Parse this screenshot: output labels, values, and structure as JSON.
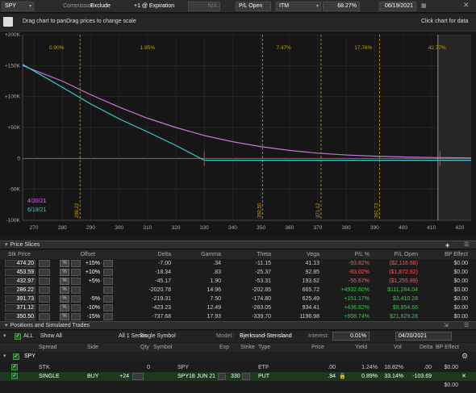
{
  "toolbar": {
    "symbol": "SPY",
    "commission_label": "Commission:",
    "commission_value": "Exclude",
    "expiration_mode": "+1 @ Expiration",
    "na_field": "N/A",
    "pl_mode": "P/L Open",
    "itm": "ITM",
    "probability": "68.27%",
    "date": "06/19/2021"
  },
  "chart_header": {
    "hint": "Drag chart to panDrag prices to change scale",
    "click_hint": "Click chart for data"
  },
  "chart_data": {
    "type": "line",
    "x_ticks": [
      270,
      280,
      290,
      300,
      310,
      320,
      330,
      340,
      350,
      360,
      370,
      380,
      390,
      400,
      410,
      420
    ],
    "y_ticks": [
      "+200K",
      "+150K",
      "+100K",
      "+50K",
      "0",
      "-50K",
      "-100K"
    ],
    "ylim": [
      -100000,
      200000
    ],
    "xlim": [
      266,
      424
    ],
    "prob_labels": [
      {
        "text": "0.90%",
        "x": 278
      },
      {
        "text": "1.95%",
        "x": 310
      },
      {
        "text": "7.47%",
        "x": 358
      },
      {
        "text": "17.76%",
        "x": 386
      },
      {
        "text": "42.77%",
        "x": 412
      }
    ],
    "vlines": [
      {
        "label": "286.22",
        "x": 286.22
      },
      {
        "label": "350.50",
        "x": 350.5
      },
      {
        "label": "371.12",
        "x": 371.12
      },
      {
        "label": "391.73",
        "x": 391.73
      }
    ],
    "solid_vline": 412.3,
    "markers": [
      330,
      413
    ],
    "series": [
      {
        "name": "4/20/21",
        "color": "#d070e0",
        "x": [
          266,
          280,
          290,
          300,
          310,
          320,
          330,
          340,
          350,
          360,
          370,
          380,
          390,
          400,
          410,
          424
        ],
        "y": [
          150000,
          125000,
          103000,
          83000,
          65000,
          50000,
          37000,
          27000,
          19000,
          13000,
          8500,
          5600,
          3700,
          2400,
          1500,
          800
        ]
      },
      {
        "name": "6/19/21",
        "color": "#30d0c8",
        "x": [
          266,
          280,
          290,
          300,
          310,
          320,
          330,
          340,
          380,
          424
        ],
        "y": [
          152000,
          115000,
          88000,
          64000,
          43000,
          21000,
          -3000,
          -3000,
          -3000,
          -3000
        ]
      }
    ]
  },
  "price_slices": {
    "title": "Price Slices",
    "headers": [
      "Stk Price",
      "Offset",
      "Delta",
      "Gamma",
      "Theta",
      "Vega",
      "P/L %",
      "P/L Open",
      "BP Effect"
    ],
    "rows": [
      {
        "price": "474.20",
        "offset": "+15%",
        "delta": "-7.00",
        "gamma": ".34",
        "theta": "-11.15",
        "vega": "41.13",
        "plpct": "-93.82%",
        "plopen": "($2,116.68)",
        "bp": "$0.00",
        "neg": true
      },
      {
        "price": "453.59",
        "offset": "+10%",
        "delta": "-18.34",
        "gamma": ".83",
        "theta": "-25.37",
        "vega": "92.85",
        "plpct": "-83.02%",
        "plopen": "($1,872.92)",
        "bp": "$0.00",
        "neg": true
      },
      {
        "price": "432.97",
        "offset": "+5%",
        "delta": "-45.17",
        "gamma": "1.90",
        "theta": "-53.31",
        "vega": "193.62",
        "plpct": "-55.67%",
        "plopen": "($1,255.89)",
        "bp": "$0.00",
        "neg": true
      },
      {
        "price": "286.22",
        "offset": "",
        "delta": "-2020.78",
        "gamma": "14.96",
        "theta": "-202.85",
        "vega": "665.72",
        "plpct": "+4932.80%",
        "plopen": "$111,284.04",
        "bp": "$0.00",
        "neg": false
      },
      {
        "price": "391.73",
        "offset": "-5%",
        "delta": "-219.31",
        "gamma": "7.50",
        "theta": "-174.80",
        "vega": "625.49",
        "plpct": "+151.17%",
        "plopen": "$3,410.28",
        "bp": "$0.00",
        "neg": false
      },
      {
        "price": "371.12",
        "offset": "-10%",
        "delta": "-423.23",
        "gamma": "12.49",
        "theta": "-263.05",
        "vega": "934.41",
        "plpct": "+436.82%",
        "plopen": "$9,854.66",
        "bp": "$0.00",
        "neg": false
      },
      {
        "price": "350.50",
        "offset": "-15%",
        "delta": "-737.68",
        "gamma": "17.93",
        "theta": "-339.70",
        "vega": "1196.98",
        "plpct": "+958.74%",
        "plopen": "$21,629.28",
        "bp": "$0.00",
        "neg": false
      }
    ]
  },
  "positions": {
    "title": "Positions and Simulated Trades",
    "all_label": "ALL",
    "show_all": "Show All",
    "series_label": "All 1 Series",
    "symbol_mode": "Single Symbol",
    "model_label": "Model:",
    "model_value": "Bjerksund-Stensland",
    "interest_label": "Interest:",
    "interest_value": "0.01%",
    "date_value": "04/20/2021",
    "headers": [
      "Spread",
      "Side",
      "Qty",
      "Symbol",
      "Exp",
      "Strike",
      "Type",
      "Price",
      "Yield",
      "Vol",
      "Delta",
      "BP Effect"
    ],
    "group": "SPY",
    "stk_row": {
      "spread": "STK",
      "qty": "0",
      "symbol": "SPY",
      "type": "ETF",
      "price": ".00",
      "yield": "1.24%",
      "vol": "18.82%",
      "delta": ".00",
      "bp": "$0.00"
    },
    "single_row": {
      "spread": "SINGLE",
      "side": "BUY",
      "qty": "+24",
      "symbol": "SPY",
      "exp": "18 JUN 21",
      "strike": "330",
      "type": "PUT",
      "price": ".94",
      "yield": "0.89%",
      "vol": "33.14%",
      "delta": "-103.69"
    },
    "total_bp": "$0.00"
  }
}
